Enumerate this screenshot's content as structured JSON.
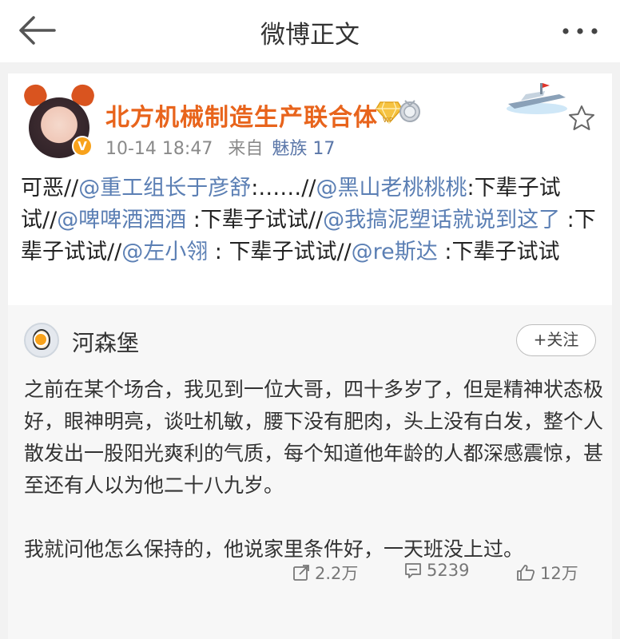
{
  "header": {
    "title": "微博正文"
  },
  "post": {
    "author": {
      "name": "北方机械制造生产联合体"
    },
    "time": "10-14 18:47",
    "source_prefix": "来自",
    "source": "魅族 17",
    "segments": [
      {
        "type": "text",
        "text": "可恶//"
      },
      {
        "type": "mention",
        "text": "@重工组长于彦舒"
      },
      {
        "type": "text",
        "text": ":……//"
      },
      {
        "type": "mention",
        "text": "@黑山老桃桃桃"
      },
      {
        "type": "text",
        "text": ":下辈子试试//"
      },
      {
        "type": "mention",
        "text": "@啤啤酒酒酒"
      },
      {
        "type": "text",
        "text": " :下辈子试试//"
      },
      {
        "type": "mention",
        "text": "@我搞泥塑话就说到这了"
      },
      {
        "type": "text",
        "text": " :下辈子试试//"
      },
      {
        "type": "mention",
        "text": "@左小翎"
      },
      {
        "type": "text",
        "text": " : 下辈子试试//"
      },
      {
        "type": "mention",
        "text": "@re斯达"
      },
      {
        "type": "text",
        "text": " :下辈子试试"
      }
    ]
  },
  "repost": {
    "author": {
      "name": "河森堡"
    },
    "follow_label": "+关注",
    "paragraph1": "之前在某个场合，我见到一位大哥，四十多岁了，但是精神状态极好，眼神明亮，谈吐机敏，腰下没有肥肉，头上没有白发，整个人散发出一股阳光爽利的气质，每个知道他年龄的人都深感震惊，甚至还有人以为他二十八九岁。",
    "paragraph2": "我就问他怎么保持的，他说家里条件好，一天班没上过。",
    "stats": {
      "reposts": "2.2万",
      "comments": "5239",
      "likes": "12万"
    }
  }
}
